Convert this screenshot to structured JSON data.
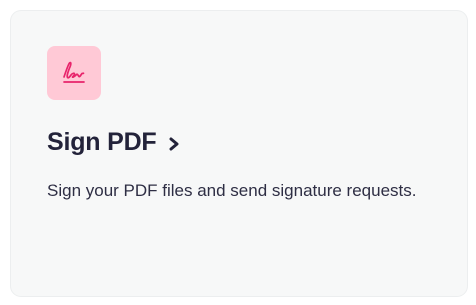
{
  "card": {
    "title": "Sign PDF",
    "description": "Sign your PDF files and send signature requests.",
    "icon": "signature-icon",
    "chevron_icon": "chevron-right-icon"
  },
  "colors": {
    "card_background": "#f7f8f8",
    "icon_background": "#ffc9d6",
    "icon_stroke": "#e8246b",
    "title_text": "#23233a",
    "body_text": "#2e2e44"
  }
}
